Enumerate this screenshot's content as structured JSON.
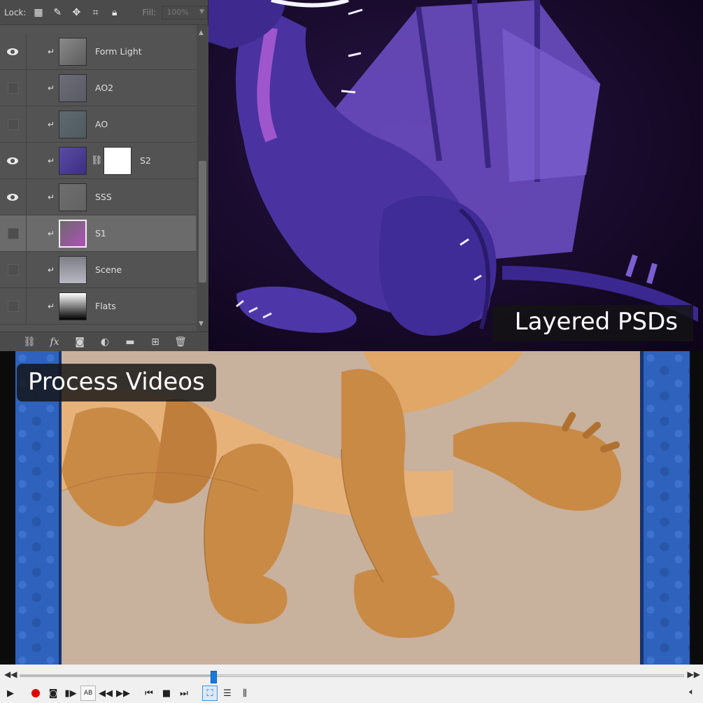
{
  "layers_panel": {
    "lock_label": "Lock:",
    "fill_label": "Fill:",
    "fill_value": "100%",
    "lock_icons": [
      "lock-transparent-pixels-icon",
      "lock-image-pixels-icon",
      "lock-position-icon",
      "lock-artboard-icon",
      "lock-all-icon"
    ],
    "layers": [
      {
        "name": "Form Light",
        "visible": true,
        "selected": false,
        "has_mask": false
      },
      {
        "name": "AO2",
        "visible": false,
        "selected": false,
        "has_mask": false
      },
      {
        "name": "AO",
        "visible": false,
        "selected": false,
        "has_mask": false
      },
      {
        "name": "S2",
        "visible": true,
        "selected": false,
        "has_mask": true
      },
      {
        "name": "SSS",
        "visible": true,
        "selected": false,
        "has_mask": false
      },
      {
        "name": "S1",
        "visible": false,
        "selected": true,
        "has_mask": false
      },
      {
        "name": "Scene",
        "visible": false,
        "selected": false,
        "has_mask": false
      },
      {
        "name": "Flats",
        "visible": false,
        "selected": false,
        "has_mask": false
      }
    ],
    "footer_icons": [
      "link-layers-icon",
      "layer-style-fx-icon",
      "add-mask-icon",
      "adjustment-layer-icon",
      "new-group-icon",
      "new-layer-icon",
      "delete-layer-icon"
    ]
  },
  "captions": {
    "top": "Layered PSDs",
    "bottom": "Process Videos"
  },
  "player": {
    "seek_position": 0.29,
    "buttons": [
      "play-icon",
      "record-icon",
      "snapshot-icon",
      "frame-step-icon",
      "loop-ab-icon",
      "slower-icon",
      "faster-icon",
      "previous-icon",
      "stop-icon",
      "next-icon",
      "fullscreen-icon",
      "playlist-icon",
      "extended-settings-icon"
    ],
    "ab_label": "AB"
  },
  "colors": {
    "panel_bg": "#535353",
    "dragon_purple": "#5b3fb0",
    "video_canvas": "#c8b19d",
    "dragon_orange": "#c98a45",
    "seek_knob": "#1a7ad9",
    "record": "#e00000"
  }
}
